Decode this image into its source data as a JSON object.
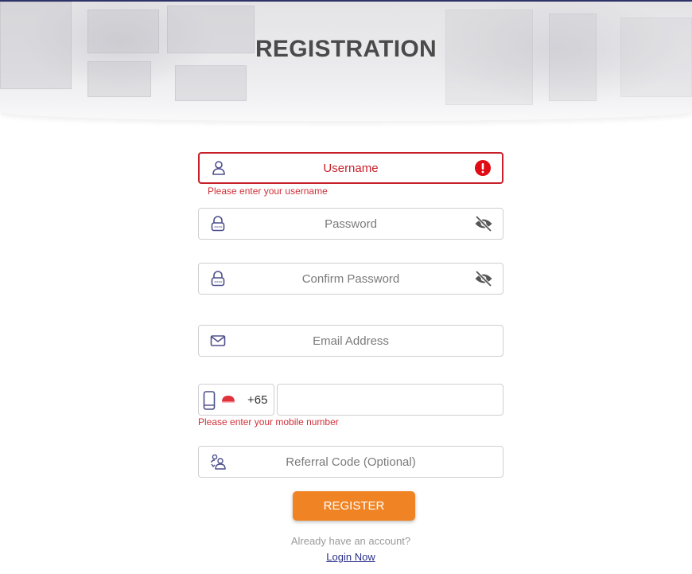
{
  "header": {
    "title": "REGISTRATION"
  },
  "form": {
    "username": {
      "placeholder": "Username",
      "icon": "user-icon",
      "status_icon": "error-exclamation-icon",
      "error": "Please enter your username"
    },
    "password": {
      "placeholder": "Password",
      "icon": "lock-icon",
      "toggle_icon": "eye-slash-icon"
    },
    "confirm_password": {
      "placeholder": "Confirm Password",
      "icon": "lock-icon",
      "toggle_icon": "eye-slash-icon"
    },
    "email": {
      "placeholder": "Email Address",
      "icon": "envelope-icon"
    },
    "mobile": {
      "icon": "phone-icon",
      "flag": "singapore-flag-icon",
      "dial_code": "+65",
      "value": "",
      "error": "Please enter your mobile number"
    },
    "referral": {
      "placeholder": "Referral Code (Optional)",
      "icon": "referral-users-icon"
    }
  },
  "actions": {
    "register_label": "REGISTER",
    "already_text": "Already have an account?",
    "login_label": "Login Now"
  },
  "colors": {
    "accent": "#f08425",
    "error": "#c8202a",
    "icon": "#4c4e8c",
    "link": "#2a2f8a"
  }
}
